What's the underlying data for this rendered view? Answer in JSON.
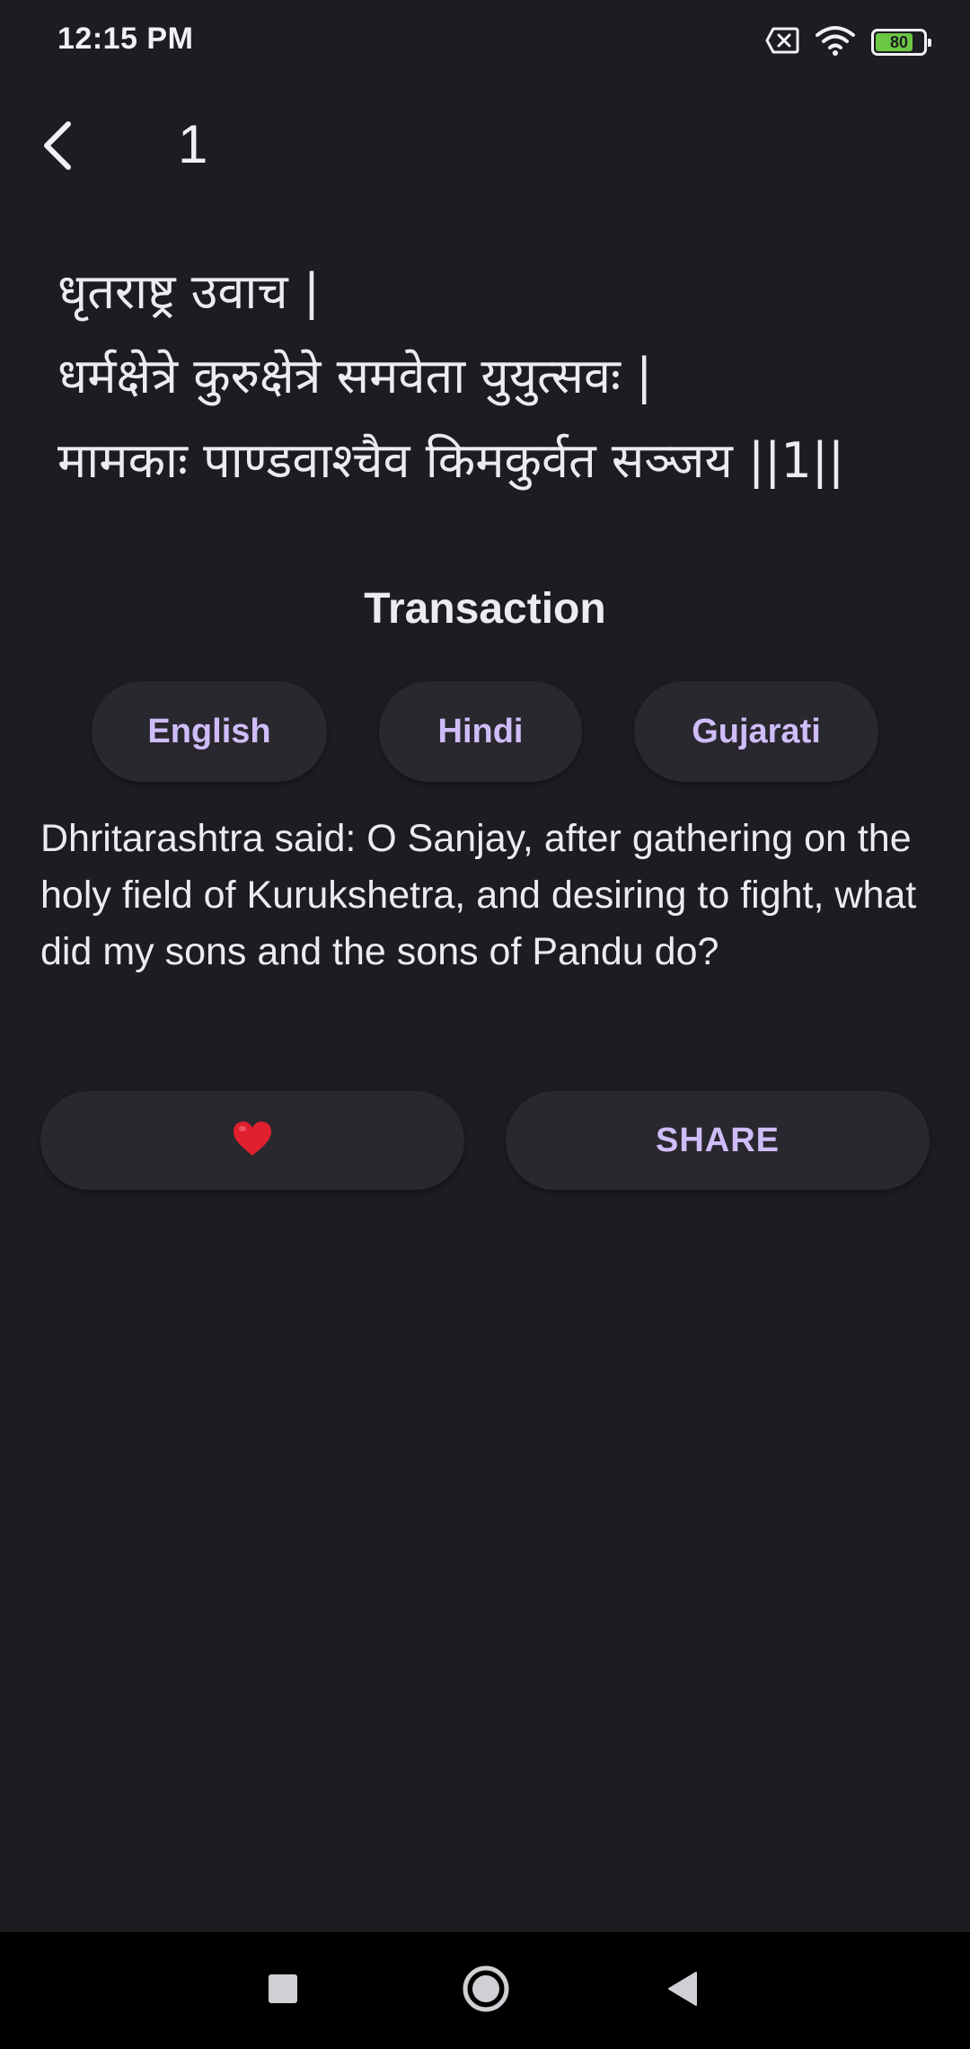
{
  "status_bar": {
    "time": "12:15 PM",
    "battery_level": "80",
    "battery_fraction": 0.8,
    "icons": [
      "no-sim-icon",
      "wifi-icon",
      "battery-icon"
    ],
    "battery_color": "#6cc644"
  },
  "app_bar": {
    "back_icon": "chevron-left-icon",
    "title": "1"
  },
  "shloka": {
    "text": "धृतराष्ट्र उवाच |\nधर्मक्षेत्रे कुरुक्षेत्रे समवेता युयुत्सवः |\nमामकाः पाण्डवाश्चैव किमकुर्वत सञ्जय ||1||"
  },
  "section": {
    "heading": "Transaction"
  },
  "language_options": {
    "english": "English",
    "hindi": "Hindi",
    "gujarati": "Gujarati"
  },
  "translation": {
    "text": "Dhritarashtra said: O Sanjay, after gathering on the holy field of Kurukshetra, and desiring to fight, what did my sons and the sons of Pandu do?"
  },
  "actions": {
    "like_icon": "❤️",
    "share_label": "SHARE"
  },
  "navigation": {
    "icons": [
      "recents-square-icon",
      "home-circle-icon",
      "back-triangle-icon"
    ]
  },
  "colors": {
    "background": "#1d1c21",
    "surface": "#29282e",
    "accent": "#cfbdfa",
    "heart": "#e0202f"
  }
}
